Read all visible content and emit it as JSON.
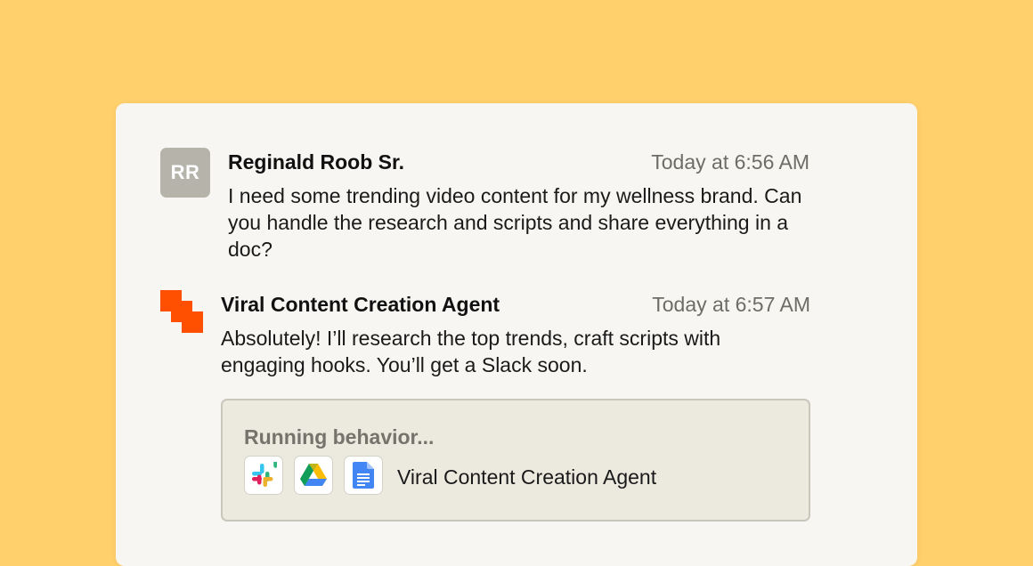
{
  "colors": {
    "background": "#FFD06C",
    "card": "#F7F6F2",
    "avatar_bg": "#B5B3AA",
    "agent_brand": "#FF4F00",
    "behavior_bg": "#ECE9DF"
  },
  "messages": [
    {
      "avatar_initials": "RR",
      "author": "Reginald Roob Sr.",
      "time": "Today at 6:56 AM",
      "text": "I need some trending video content for my wellness brand. Can you handle the research and scripts and share everything in a doc?"
    },
    {
      "avatar_icon": "agent-logo-icon",
      "author": "Viral Content Creation Agent",
      "time": "Today at 6:57 AM",
      "text": "Absolutely! I’ll research the top trends, craft scripts with engaging hooks. You’ll get a Slack soon."
    }
  ],
  "behavior": {
    "status": "Running behavior...",
    "apps": [
      "slack-icon",
      "google-drive-icon",
      "google-docs-icon"
    ],
    "agent_name": "Viral Content Creation Agent"
  }
}
